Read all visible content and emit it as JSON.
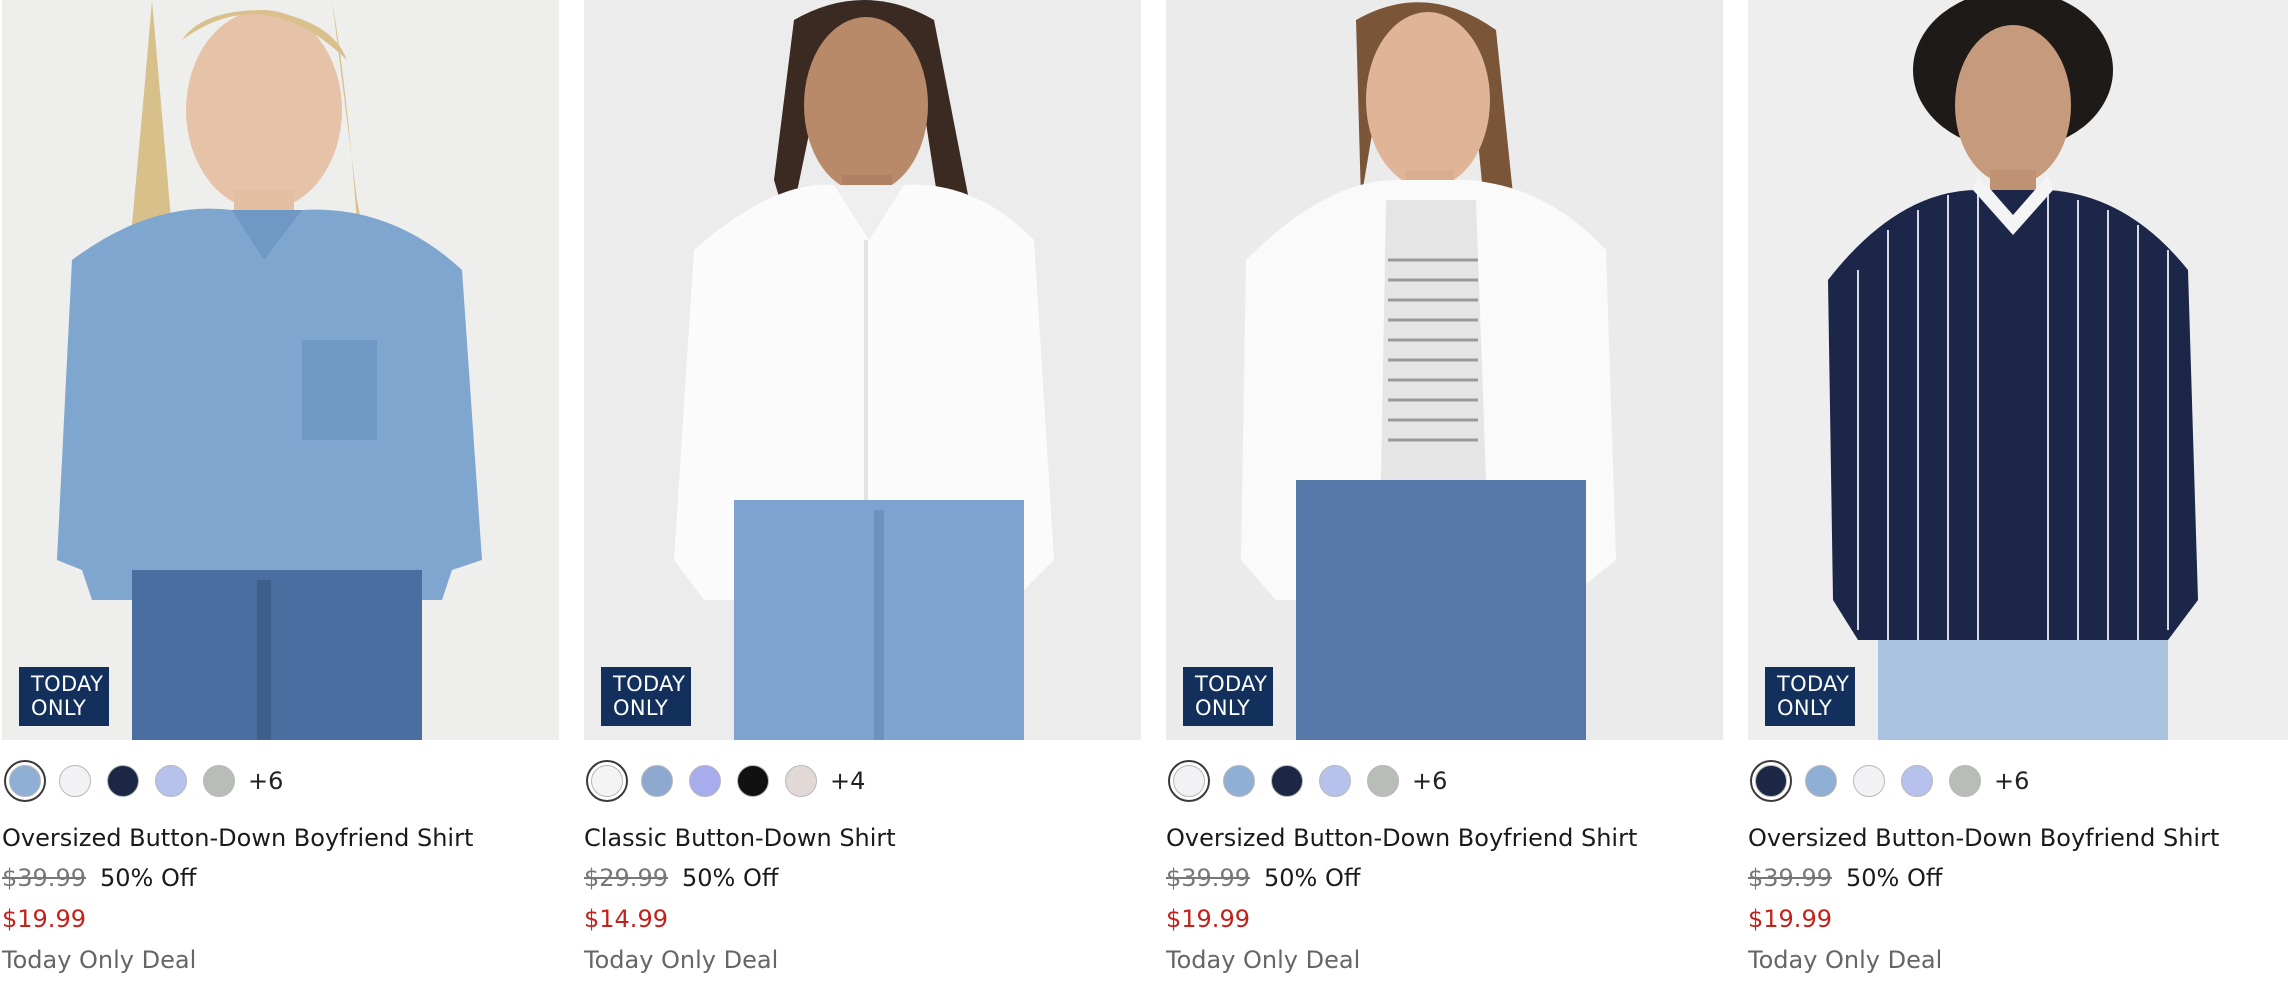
{
  "products": [
    {
      "badge": [
        "TODAY",
        "ONLY"
      ],
      "title": "Oversized Button-Down Boyfriend Shirt",
      "original_price": "$39.99",
      "discount": "50% Off",
      "sale_price": "$19.99",
      "promo": "Today Only Deal",
      "more_colors": "+6",
      "swatches": [
        "#8fb0d4",
        "#f2f2f4",
        "#1b2744",
        "#b6c1ec",
        "#b8bdb8"
      ]
    },
    {
      "badge": [
        "TODAY",
        "ONLY"
      ],
      "title": "Classic Button-Down Shirt",
      "original_price": "$29.99",
      "discount": "50% Off",
      "sale_price": "$14.99",
      "promo": "Today Only Deal",
      "more_colors": "+4",
      "swatches": [
        "#f4f4f4",
        "#8ea9cf",
        "#a6acec",
        "#111111",
        "#e2d9d6"
      ]
    },
    {
      "badge": [
        "TODAY",
        "ONLY"
      ],
      "title": "Oversized Button-Down Boyfriend Shirt",
      "original_price": "$39.99",
      "discount": "50% Off",
      "sale_price": "$19.99",
      "promo": "Today Only Deal",
      "more_colors": "+6",
      "swatches": [
        "#f2f2f4",
        "#8fb0d4",
        "#1b2744",
        "#b6c1ec",
        "#b8bdb8"
      ]
    },
    {
      "badge": [
        "TODAY",
        "ONLY"
      ],
      "title": "Oversized Button-Down Boyfriend Shirt",
      "original_price": "$39.99",
      "discount": "50% Off",
      "sale_price": "$19.99",
      "promo": "Today Only Deal",
      "more_colors": "+6",
      "swatches": [
        "#1b2744",
        "#8fb0d4",
        "#f2f2f4",
        "#b6c1ec",
        "#b8bdb8"
      ]
    }
  ],
  "colors": {
    "badge_bg": "#12305b",
    "sale_price": "#c3221c",
    "muted_text": "#666666"
  }
}
